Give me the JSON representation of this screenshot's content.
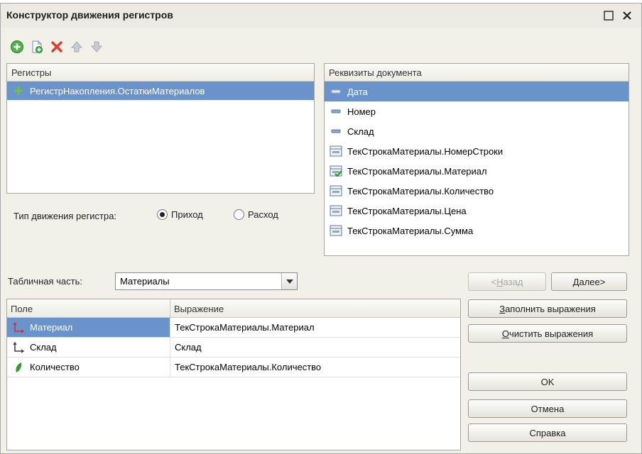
{
  "window": {
    "title": "Конструктор движения регистров"
  },
  "toolbar": {
    "icons": [
      "add-icon",
      "copy-icon",
      "delete-icon",
      "move-up-icon",
      "move-down-icon"
    ]
  },
  "registers": {
    "header": "Регистры",
    "items": [
      {
        "label": "РегистрНакопления.ОстаткиМатериалов",
        "selected": true
      }
    ]
  },
  "movement_type": {
    "label": "Тип движения регистра:",
    "options": [
      "Приход",
      "Расход"
    ],
    "selected": "Приход"
  },
  "requisites": {
    "header": "Реквизиты документа",
    "items": [
      {
        "label": "Дата",
        "icon": "attribute-icon",
        "selected": true
      },
      {
        "label": "Номер",
        "icon": "attribute-icon"
      },
      {
        "label": "Склад",
        "icon": "attribute-icon"
      },
      {
        "label": "ТекСтрокаМатериалы.НомерСтроки",
        "icon": "table-attribute-icon"
      },
      {
        "label": "ТекСтрокаМатериалы.Материал",
        "icon": "table-attribute-used-icon"
      },
      {
        "label": "ТекСтрокаМатериалы.Количество",
        "icon": "table-attribute-icon"
      },
      {
        "label": "ТекСтрокаМатериалы.Цена",
        "icon": "table-attribute-icon"
      },
      {
        "label": "ТекСтрокаМатериалы.Сумма",
        "icon": "table-attribute-icon"
      }
    ]
  },
  "tabular": {
    "label": "Табличная часть:",
    "value": "Материалы"
  },
  "nav": {
    "back_prefix": "<",
    "back_key": "Н",
    "back_rest": "азад",
    "next_key": "Д",
    "next_rest": "алее>"
  },
  "actions": {
    "fill_key": "З",
    "fill_rest": "аполнить выражения",
    "clear_key": "О",
    "clear_rest": "чистить выражения",
    "ok": "OK",
    "cancel": "Отмена",
    "help": "Справка"
  },
  "grid": {
    "col_field": "Поле",
    "col_expression": "Выражение",
    "rows": [
      {
        "field": "Материал",
        "expression": "ТекСтрокаМатериалы.Материал",
        "icon": "dimension-icon",
        "selected": true
      },
      {
        "field": "Склад",
        "expression": "Склад",
        "icon": "dimension-icon"
      },
      {
        "field": "Количество",
        "expression": "ТекСтрокаМатериалы.Количество",
        "icon": "resource-icon"
      }
    ]
  },
  "colors": {
    "selection": "#6b93cb",
    "background": "#f1f1ea"
  }
}
